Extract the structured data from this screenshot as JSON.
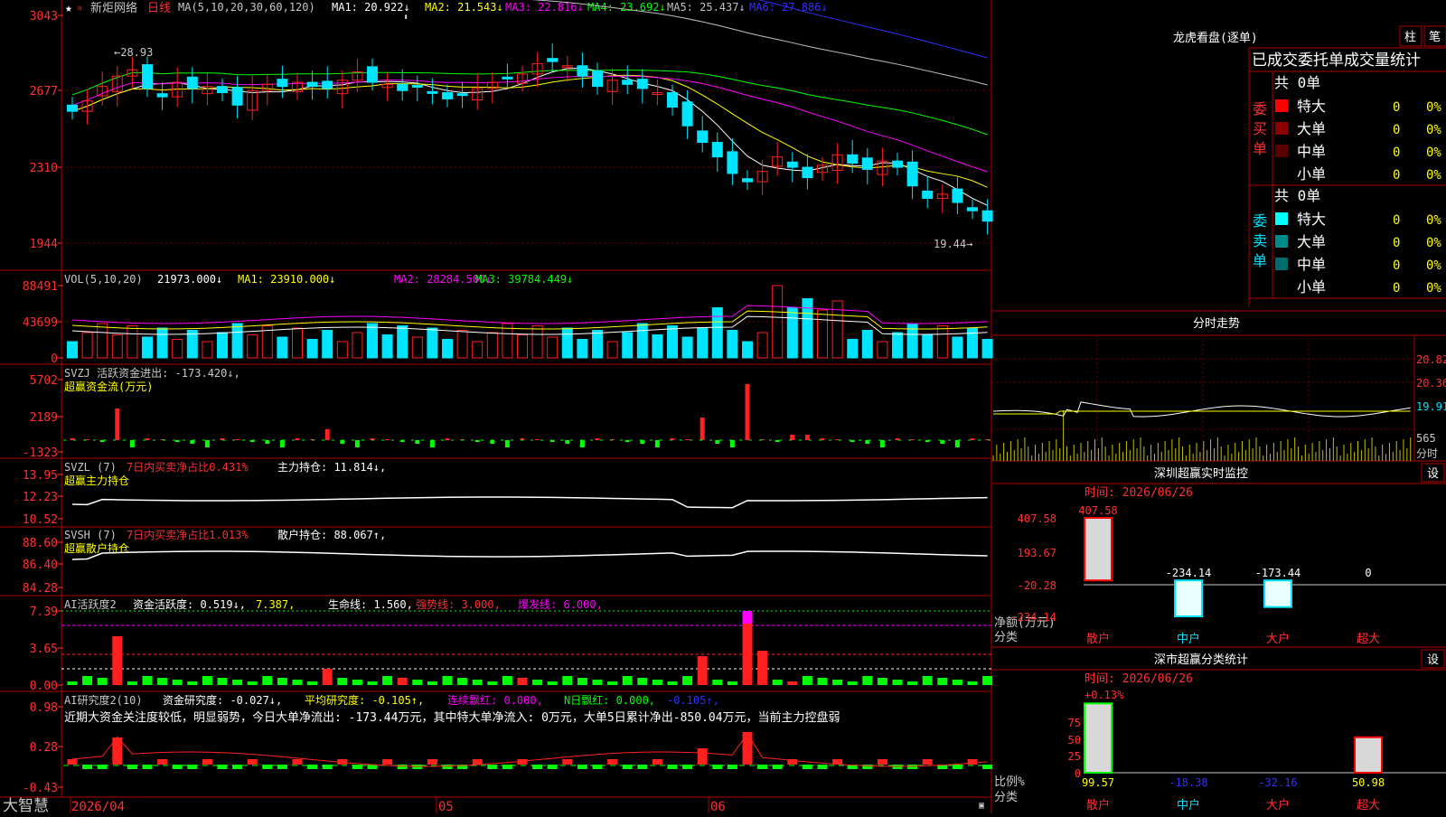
{
  "stock": {
    "name": "新炬网络",
    "period": "日线"
  },
  "price_panel": {
    "ma_params": "MA(5,10,20,30,60,120)",
    "ma_items": [
      {
        "label": "MA1:",
        "value": "20.922",
        "arrow": "↓",
        "color": "#ffffff"
      },
      {
        "label": "MA2:",
        "value": "21.543",
        "arrow": "↓",
        "color": "#ffff00"
      },
      {
        "label": "MA3:",
        "value": "22.816",
        "arrow": "↓",
        "color": "#ff00ff"
      },
      {
        "label": "MA4:",
        "value": "23.692",
        "arrow": "↓",
        "color": "#00ff00"
      },
      {
        "label": "MA5:",
        "value": "25.437",
        "arrow": "↓",
        "color": "#c0c0c0"
      },
      {
        "label": "MA6:",
        "value": "27.886",
        "arrow": "↓",
        "color": "#3030ff"
      }
    ],
    "y_ticks": [
      "3043",
      "2677",
      "2310",
      "1944"
    ],
    "high_label": "←28.93",
    "low_label": "19.44→"
  },
  "vol_panel": {
    "header": "VOL(5,10,20)",
    "items": [
      {
        "text": "21973.000↓",
        "color": "#ffffff"
      },
      {
        "text": "MA1: 23910.000↓",
        "color": "#ffff00"
      },
      {
        "text": "MA2: 28284.500↓",
        "color": "#ff00ff"
      },
      {
        "text": "MA3: 39784.449↓",
        "color": "#00ff00"
      }
    ],
    "y_ticks": [
      "88491",
      "43699",
      "0"
    ]
  },
  "svzj_panel": {
    "line1": "SVZJ  活跃资金进出: -173.420↓,",
    "line2": "超赢资金流(万元)",
    "y_ticks": [
      "5702",
      "2189",
      "-1323"
    ]
  },
  "svzl_panel": {
    "name": "SVZL (7)",
    "desc": "7日内买卖净占比0.431%",
    "hold": "主力持仓: 11.814↓,",
    "line2": "超赢主力持仓",
    "y_ticks": [
      "13.95",
      "12.23",
      "10.52"
    ]
  },
  "svsh_panel": {
    "name": "SVSH (7)",
    "desc": "7日内买卖净占比1.013%",
    "hold": "散户持仓: 88.067↑,",
    "line2": "超赢散户持仓",
    "y_ticks": [
      "88.60",
      "86.40",
      "84.28"
    ]
  },
  "ai_active_panel": {
    "name": "AI活跃度2",
    "items": [
      {
        "text": "资金活跃度: 0.519↓,",
        "color": "#ffffff"
      },
      {
        "text": "7.387,",
        "color": "#ffff00"
      },
      {
        "text": "生命线: 1.560,",
        "color": "#ffffff"
      },
      {
        "text": "强势线: 3.000,",
        "color": "#ff3030"
      },
      {
        "text": "爆发线: 6.000,",
        "color": "#ff00ff"
      }
    ],
    "y_ticks": [
      "7.39",
      "3.65",
      "0.00"
    ]
  },
  "ai_research_panel": {
    "name": "AI研究度2(10)",
    "items": [
      {
        "text": "资金研究度: -0.027↓,",
        "color": "#ffffff"
      },
      {
        "text": "平均研究度: -0.105↑,",
        "color": "#ffff00"
      },
      {
        "text": "连续飘红: 0.000,",
        "color": "#ff00ff"
      },
      {
        "text": "N日飘红: 0.000,",
        "color": "#00ff00"
      },
      {
        "text": "-0.105↑,",
        "color": "#3030ff"
      }
    ],
    "commentary": "近期大资金关注度较低，明显弱势，今日大单净流出: -173.44万元，其中特大单净流入: 0万元，大单5日累计净出-850.04万元，当前主力控盘弱",
    "y_ticks": [
      "0.98",
      "0.28",
      "-0.43"
    ]
  },
  "bottom_bar": {
    "logo": "大智慧",
    "dates": [
      "2026/04",
      "05",
      "06"
    ]
  },
  "dragon": {
    "title": "龙虎看盘(逐单)",
    "tab1": "柱",
    "tab2": "笔",
    "header": "已成交委托单成交量统计",
    "buy_label": "委买单",
    "sell_label": "委卖单",
    "buy_total": "共 0单",
    "sell_total": "共 0单",
    "buy_rows": [
      {
        "label": "特大",
        "qty": "0",
        "pct": "0%",
        "color": "#ff0000"
      },
      {
        "label": "大单",
        "qty": "0",
        "pct": "0%",
        "color": "#8b0000"
      },
      {
        "label": "中单",
        "qty": "0",
        "pct": "0%",
        "color": "#5a0000"
      },
      {
        "label": "小单",
        "qty": "0",
        "pct": "0%",
        "color": ""
      }
    ],
    "sell_rows": [
      {
        "label": "特大",
        "qty": "0",
        "pct": "0%",
        "color": "#00ffff"
      },
      {
        "label": "大单",
        "qty": "0",
        "pct": "0%",
        "color": "#008b8b"
      },
      {
        "label": "中单",
        "qty": "0",
        "pct": "0%",
        "color": "#006b6b"
      },
      {
        "label": "小单",
        "qty": "0",
        "pct": "0%",
        "color": ""
      }
    ]
  },
  "intraday": {
    "title": "分时走势",
    "prices": [
      "20.82",
      "20.36",
      "19.91"
    ],
    "volume_label": "565",
    "bottom_label": "分时"
  },
  "realtime_monitor": {
    "title": "深圳超赢实时监控",
    "set_label": "设",
    "date": "时间: 2026/06/26",
    "y_ticks": [
      "407.58",
      "193.67",
      "-20.28",
      "-234.14"
    ],
    "y_caption": "净额(万元)",
    "x_caption": "分类",
    "categories": [
      "散户",
      "中户",
      "大户",
      "超大"
    ],
    "values": [
      407.58,
      -234.14,
      -173.44,
      0
    ],
    "value_labels": [
      "407.58",
      "-234.14",
      "-173.44",
      "0"
    ]
  },
  "classify": {
    "title": "深市超赢分类统计",
    "set_label": "设",
    "date": "时间: 2026/06/26",
    "top_label": "+0.13%",
    "y_ticks": [
      "75",
      "50",
      "25",
      "0"
    ],
    "y_caption": "比例%",
    "x_caption": "分类",
    "categories": [
      "散户",
      "中户",
      "大户",
      "超大"
    ],
    "values": [
      99.57,
      -18.38,
      -32.16,
      50.98
    ],
    "value_labels": [
      "99.57",
      "-18.38",
      "-32.16",
      "50.98"
    ]
  },
  "chart_data": [
    {
      "type": "candlestick",
      "series": [
        {
          "name": "MA1",
          "values": [
            20.922
          ]
        },
        {
          "name": "MA2",
          "values": [
            21.543
          ]
        },
        {
          "name": "MA3",
          "values": [
            22.816
          ]
        },
        {
          "name": "MA4",
          "values": [
            23.692
          ]
        },
        {
          "name": "MA5",
          "values": [
            25.437
          ]
        },
        {
          "name": "MA6",
          "values": [
            27.886
          ]
        }
      ],
      "high": 28.93,
      "low": 19.44
    },
    {
      "type": "bar",
      "categories": [
        "散户",
        "中户",
        "大户",
        "超大"
      ],
      "values": [
        407.58,
        -234.14,
        -173.44,
        0
      ],
      "title": "深圳超赢实时监控",
      "ylabel": "净额(万元)"
    },
    {
      "type": "bar",
      "categories": [
        "散户",
        "中户",
        "大户",
        "超大"
      ],
      "values": [
        99.57,
        -18.38,
        -32.16,
        50.98
      ],
      "title": "深市超赢分类统计",
      "ylabel": "比例%"
    }
  ],
  "colors": {
    "up": "#ff2020",
    "down": "#00e5ff",
    "grid": "#b00000",
    "label": "#ff3030",
    "text": "#c8c8c8",
    "yellow": "#ffff00"
  }
}
